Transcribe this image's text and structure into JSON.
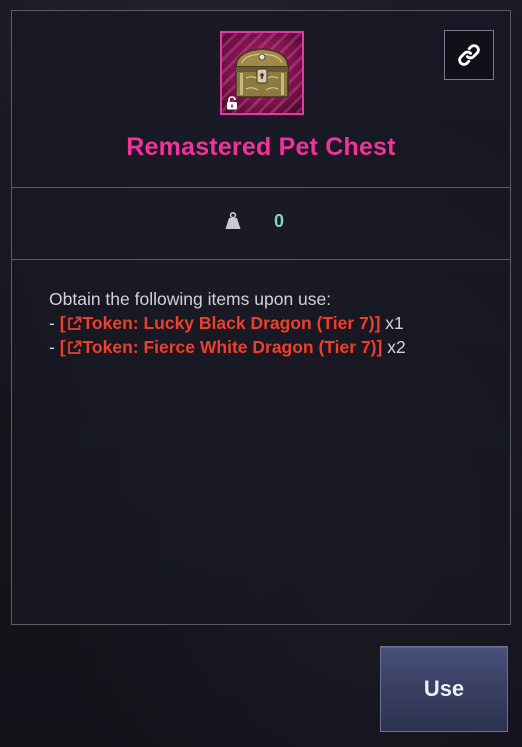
{
  "item": {
    "name": "Remastered Pet Chest",
    "icon": "treasure-chest-icon",
    "rarity_color": "#f0329a",
    "locked_state_icon": "unlock-icon"
  },
  "header": {
    "link_button_icon": "link-icon"
  },
  "stats": {
    "weight_icon": "weight-icon",
    "weight_value": "0"
  },
  "description": {
    "intro": "Obtain the following items upon use:",
    "rewards": [
      {
        "prefix": "- ",
        "open_bracket": "[",
        "name": "Token: Lucky Black Dragon (Tier 7)",
        "close_bracket": "]",
        "quantity": " x1",
        "link_icon": "external-link-icon"
      },
      {
        "prefix": "- ",
        "open_bracket": "[",
        "name": "Token: Fierce White Dragon (Tier 7)",
        "close_bracket": "]",
        "quantity": " x2",
        "link_icon": "external-link-icon"
      }
    ]
  },
  "actions": {
    "use_label": "Use"
  },
  "colors": {
    "title": "#f0329a",
    "item_link": "#f03e2a",
    "weight_value": "#7fd6c9",
    "border": "#5d5a6c",
    "use_button": "#394063"
  }
}
